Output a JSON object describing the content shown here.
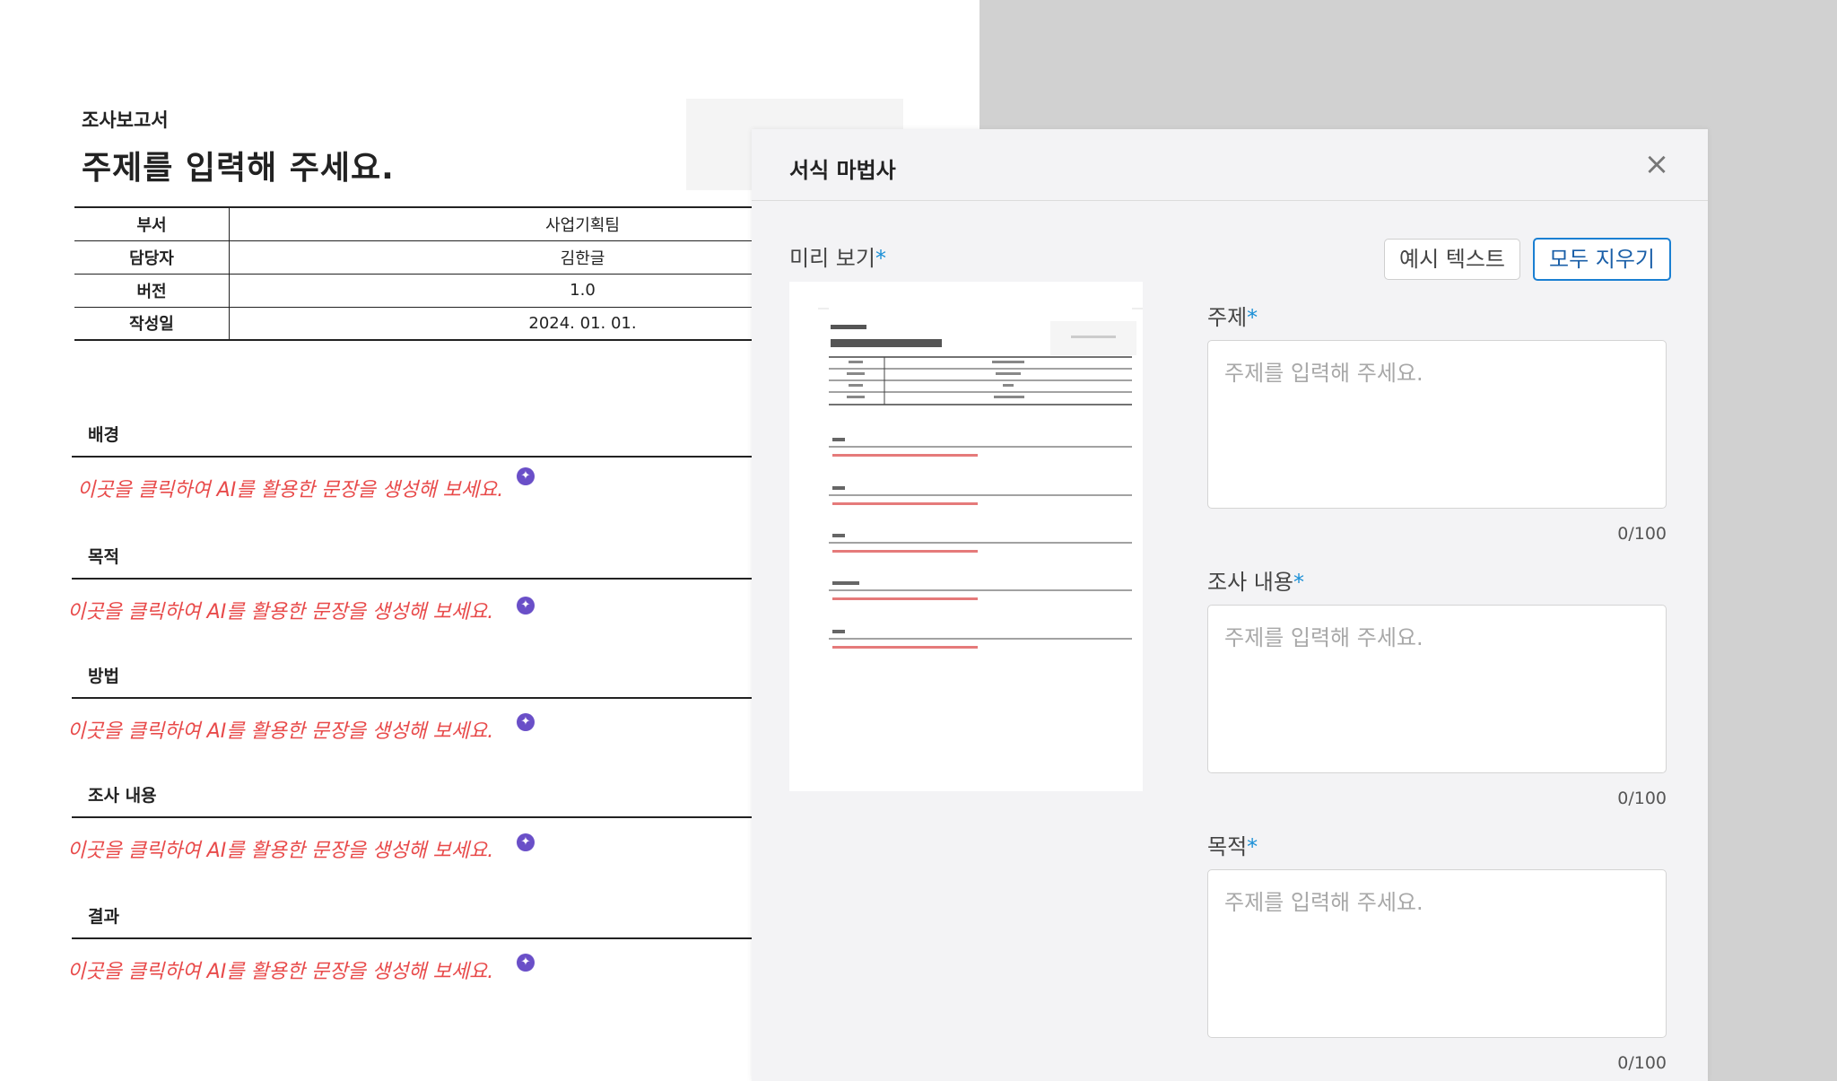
{
  "document": {
    "kicker": "조사보고서",
    "title": "주제를 입력해 주세요.",
    "info_rows": [
      {
        "label": "부서",
        "value": "사업기획팀"
      },
      {
        "label": "담당자",
        "value": "김한글"
      },
      {
        "label": "버전",
        "value": "1.0"
      },
      {
        "label": "작성일",
        "value": "2024. 01. 01."
      }
    ],
    "sections": [
      {
        "heading": "배경",
        "ai_prompt": "이곳을 클릭하여 AI를 활용한 문장을 생성해 보세요."
      },
      {
        "heading": "목적",
        "ai_prompt": "이곳을 클릭하여 AI를 활용한 문장을 생성해 보세요."
      },
      {
        "heading": "방법",
        "ai_prompt": "이곳을 클릭하여 AI를 활용한 문장을 생성해 보세요."
      },
      {
        "heading": "조사 내용",
        "ai_prompt": "이곳을 클릭하여 AI를 활용한 문장을 생성해 보세요."
      },
      {
        "heading": "결과",
        "ai_prompt": "이곳을 클릭하여 AI를 활용한 문장을 생성해 보세요."
      }
    ]
  },
  "modal": {
    "title": "서식 마법사",
    "close_icon": "close-icon",
    "preview_label": "미리 보기",
    "required_mark": "*",
    "example_button": "예시 텍스트",
    "clear_button": "모두 지우기",
    "fields": [
      {
        "label": "주제",
        "placeholder": "주제를 입력해 주세요.",
        "value": "",
        "counter": "0/100"
      },
      {
        "label": "조사 내용",
        "placeholder": "주제를 입력해 주세요.",
        "value": "",
        "counter": "0/100"
      },
      {
        "label": "목적",
        "placeholder": "주제를 입력해 주세요.",
        "value": "",
        "counter": "0/100"
      }
    ]
  },
  "colors": {
    "ai_prompt": "#e84a4a",
    "required": "#1a8fd6",
    "primary_button_border": "#1a7fd2",
    "ai_icon": "#6a4fc8",
    "backdrop": "#d1d1d1"
  }
}
